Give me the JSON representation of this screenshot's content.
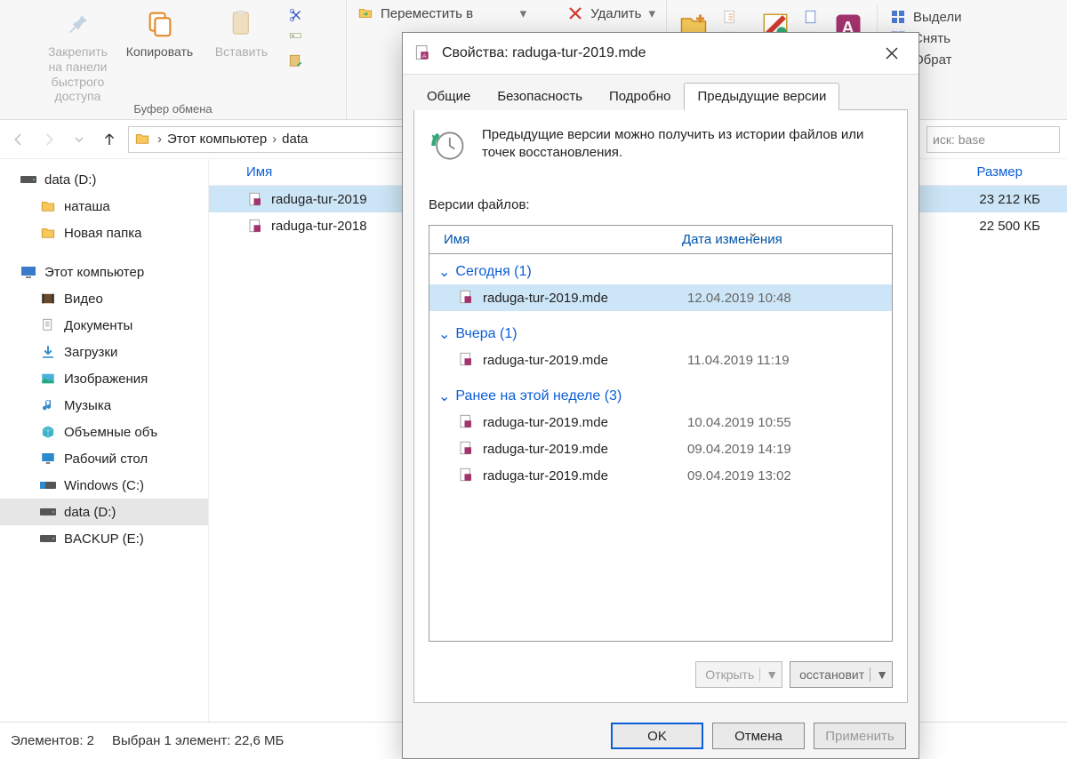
{
  "ribbon": {
    "pin": "Закрепить на панели быстрого доступа",
    "copy": "Копировать",
    "paste": "Вставить",
    "group_clipboard": "Буфер обмена",
    "move_to": "Переместить в",
    "delete": "Удалить",
    "select_all": "Выдели",
    "deselect": "Снять",
    "invert": "Обрат"
  },
  "addr": {
    "crumb1": "Этот компьютер",
    "crumb2": "data",
    "search_placeholder": "иск: base"
  },
  "nav": {
    "data_d": "data (D:)",
    "natasha": "наташа",
    "new_folder": "Новая папка",
    "this_pc": "Этот компьютер",
    "video": "Видео",
    "documents": "Документы",
    "downloads": "Загрузки",
    "pictures": "Изображения",
    "music": "Музыка",
    "volumetric": "Объемные объ",
    "desktop": "Рабочий стол",
    "windows_c": "Windows (C:)",
    "data_d2": "data (D:)",
    "backup_e": "BACKUP (E:)"
  },
  "files": {
    "col_name": "Имя",
    "col_size": "Размер",
    "rows": [
      {
        "name": "raduga-tur-2019",
        "size": "23 212 КБ"
      },
      {
        "name": "raduga-tur-2018",
        "size": "22 500 КБ"
      }
    ]
  },
  "status": {
    "elements": "Элементов: 2",
    "selected": "Выбран 1 элемент: 22,6 МБ"
  },
  "dialog": {
    "title": "Свойства: raduga-tur-2019.mde",
    "tabs": {
      "general": "Общие",
      "security": "Безопасность",
      "details": "Подробно",
      "previous": "Предыдущие версии"
    },
    "info": "Предыдущие версии можно получить из истории файлов или точек восстановления.",
    "versions_label": "Версии файлов:",
    "col_name": "Имя",
    "col_date": "Дата изменения",
    "groups": [
      {
        "title": "Сегодня (1)",
        "rows": [
          {
            "name": "raduga-tur-2019.mde",
            "date": "12.04.2019 10:48",
            "selected": true
          }
        ]
      },
      {
        "title": "Вчера (1)",
        "rows": [
          {
            "name": "raduga-tur-2019.mde",
            "date": "11.04.2019 11:19"
          }
        ]
      },
      {
        "title": "Ранее на этой неделе (3)",
        "rows": [
          {
            "name": "raduga-tur-2019.mde",
            "date": "10.04.2019 10:55"
          },
          {
            "name": "raduga-tur-2019.mde",
            "date": "09.04.2019 14:19"
          },
          {
            "name": "raduga-tur-2019.mde",
            "date": "09.04.2019 13:02"
          }
        ]
      }
    ],
    "open": "Открыть",
    "restore": "осстановит",
    "ok": "OK",
    "cancel": "Отмена",
    "apply": "Применить"
  }
}
